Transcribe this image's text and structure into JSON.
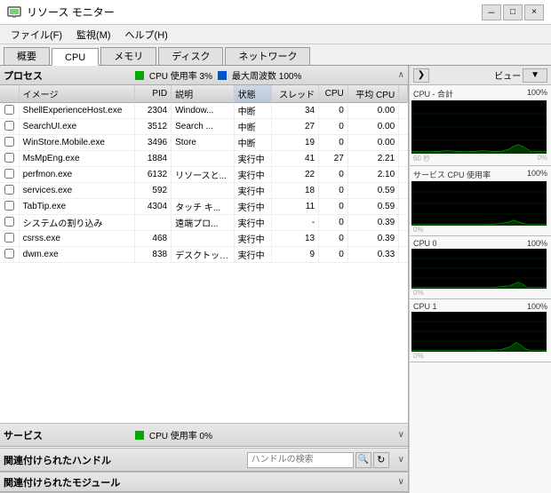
{
  "window": {
    "title": "リソース モニター",
    "icon": "monitor-icon",
    "controls": {
      "minimize": "－",
      "maximize": "□",
      "close": "×"
    }
  },
  "menu": {
    "items": [
      {
        "id": "file",
        "label": "ファイル(F)"
      },
      {
        "id": "monitor",
        "label": "監視(M)"
      },
      {
        "id": "help",
        "label": "ヘルプ(H)"
      }
    ]
  },
  "tabs": [
    {
      "id": "overview",
      "label": "概要",
      "active": false
    },
    {
      "id": "cpu",
      "label": "CPU",
      "active": true
    },
    {
      "id": "memory",
      "label": "メモリ"
    },
    {
      "id": "disk",
      "label": "ディスク"
    },
    {
      "id": "network",
      "label": "ネットワーク"
    }
  ],
  "process_section": {
    "title": "プロセス",
    "cpu_usage_label": "CPU 使用率 3%",
    "max_freq_label": "最大周波数 100%",
    "columns": [
      {
        "id": "checkbox",
        "label": ""
      },
      {
        "id": "image",
        "label": "イメージ"
      },
      {
        "id": "pid",
        "label": "PID"
      },
      {
        "id": "description",
        "label": "説明"
      },
      {
        "id": "status",
        "label": "状態"
      },
      {
        "id": "threads",
        "label": "スレッド"
      },
      {
        "id": "cpu",
        "label": "CPU"
      },
      {
        "id": "avg_cpu",
        "label": "平均 CPU"
      }
    ],
    "rows": [
      {
        "image": "ShellExperienceHost.exe",
        "pid": "2304",
        "description": "Window...",
        "status": "中断",
        "threads": "34",
        "cpu": "0",
        "avg_cpu": "0.00"
      },
      {
        "image": "SearchUI.exe",
        "pid": "3512",
        "description": "Search ...",
        "status": "中断",
        "threads": "27",
        "cpu": "0",
        "avg_cpu": "0.00"
      },
      {
        "image": "WinStore.Mobile.exe",
        "pid": "3496",
        "description": "Store",
        "status": "中断",
        "threads": "19",
        "cpu": "0",
        "avg_cpu": "0.00"
      },
      {
        "image": "MsMpEng.exe",
        "pid": "1884",
        "description": "",
        "status": "実行中",
        "threads": "41",
        "cpu": "27",
        "avg_cpu": "2.21"
      },
      {
        "image": "perfmon.exe",
        "pid": "6132",
        "description": "リソースと...",
        "status": "実行中",
        "threads": "22",
        "cpu": "0",
        "avg_cpu": "2.10"
      },
      {
        "image": "services.exe",
        "pid": "592",
        "description": "",
        "status": "実行中",
        "threads": "18",
        "cpu": "0",
        "avg_cpu": "0.59"
      },
      {
        "image": "TabTip.exe",
        "pid": "4304",
        "description": "タッチ キ...",
        "status": "実行中",
        "threads": "11",
        "cpu": "0",
        "avg_cpu": "0.59"
      },
      {
        "image": "システムの割り込み",
        "pid": "",
        "description": "遠端プロ...",
        "status": "実行中",
        "threads": "-",
        "cpu": "0",
        "avg_cpu": "0.39"
      },
      {
        "image": "csrss.exe",
        "pid": "468",
        "description": "",
        "status": "実行中",
        "threads": "13",
        "cpu": "0",
        "avg_cpu": "0.39"
      },
      {
        "image": "dwm.exe",
        "pid": "838",
        "description": "デスクトップ...",
        "status": "実行中",
        "threads": "9",
        "cpu": "0",
        "avg_cpu": "0.33"
      }
    ]
  },
  "service_section": {
    "title": "サービス",
    "cpu_label": "CPU 使用率 0%"
  },
  "handle_section": {
    "title": "関連付けられたハンドル",
    "search_placeholder": "ハンドルの検索"
  },
  "module_section": {
    "title": "関連付けられたモジュール"
  },
  "right_panel": {
    "arrow_btn": "❯",
    "view_label": "ビュー",
    "charts": [
      {
        "id": "cpu-total",
        "label": "CPU - 合計",
        "pct_top": "100%",
        "pct_bottom": "0%",
        "time_label_left": "60 秒",
        "time_label_right": ""
      },
      {
        "id": "service-cpu",
        "label": "サービス CPU 使用率",
        "pct_top": "100%",
        "pct_bottom": "0%"
      },
      {
        "id": "cpu0",
        "label": "CPU 0",
        "pct_top": "100%",
        "pct_bottom": "0%"
      },
      {
        "id": "cpu1",
        "label": "CPU 1",
        "pct_top": "100%",
        "pct_bottom": "0%"
      }
    ]
  }
}
